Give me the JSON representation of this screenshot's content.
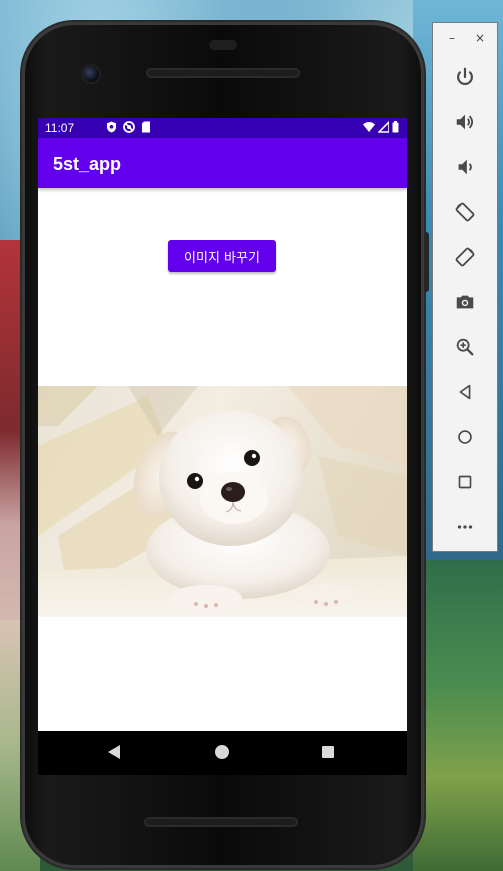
{
  "status_bar": {
    "time": "11:07",
    "left_icons": [
      "shield-icon",
      "blocked-icon",
      "sd-card-icon"
    ],
    "right_icons": [
      "wifi-icon",
      "cell-signal-icon",
      "battery-icon"
    ]
  },
  "app": {
    "title": "5st_app",
    "change_image_button_label": "이미지 바꾸기",
    "image_description": "white puppy"
  },
  "navigation": {
    "buttons": [
      "back",
      "home",
      "recents"
    ]
  },
  "emulator_toolbar": {
    "minimize_label": "–",
    "close_label": "×",
    "tools": [
      "power-icon",
      "volume-up-icon",
      "volume-down-icon",
      "rotate-left-icon",
      "rotate-right-icon",
      "camera-icon",
      "zoom-icon",
      "back-icon",
      "home-icon",
      "overview-icon",
      "more-icon"
    ]
  },
  "colors": {
    "primary": "#6200ee",
    "primary_dark": "#3700b3",
    "screen_background": "#ffffff",
    "nav_bar": "#000000"
  }
}
